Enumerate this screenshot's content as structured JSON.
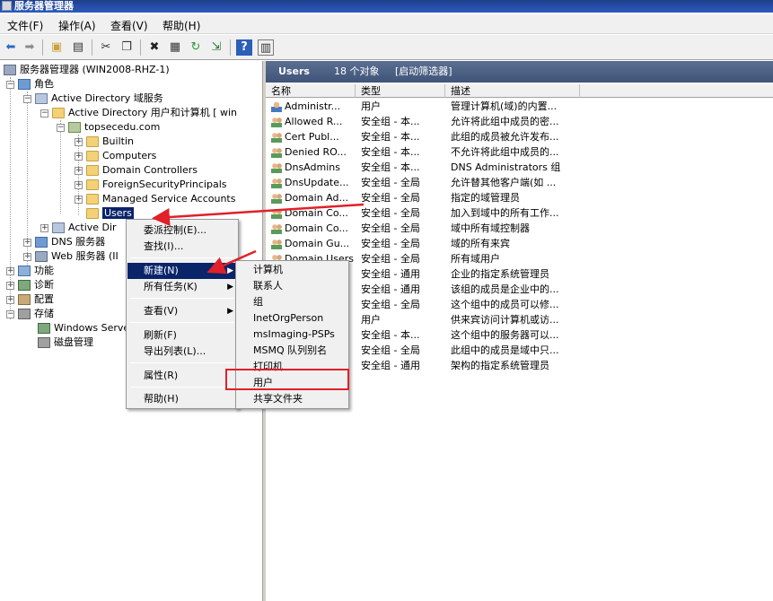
{
  "window": {
    "title": "服务器管理器"
  },
  "menubar": [
    "文件(F)",
    "操作(A)",
    "查看(V)",
    "帮助(H)"
  ],
  "toolbar": {
    "icons": [
      "back-icon",
      "forward-icon",
      "up-folder-icon",
      "show-hide-tree-icon",
      "cut-icon",
      "copy-icon",
      "delete-icon",
      "properties-icon",
      "refresh-icon",
      "export-icon",
      "help-icon",
      "view-icon"
    ]
  },
  "tree": {
    "root": "服务器管理器 (WIN2008-RHZ-1)",
    "roles": "角色",
    "ad_ds": "Active Directory 域服务",
    "aduc": "Active Directory 用户和计算机 [ win",
    "domain": "topsecedu.com",
    "containers": [
      "Builtin",
      "Computers",
      "Domain Controllers",
      "ForeignSecurityPrincipals",
      "Managed Service Accounts",
      "Users"
    ],
    "ad_other": "Active Dir",
    "dns": "DNS 服务器",
    "web": "Web 服务器 (II",
    "features": "功能",
    "diagnostics": "诊断",
    "configuration": "配置",
    "storage": "存储",
    "wsb": "Windows Serve",
    "disk_mgmt": "磁盘管理"
  },
  "right_header": {
    "title": "Users",
    "count": "18 个对象",
    "filter": "[启动筛选器]"
  },
  "columns": [
    "名称",
    "类型",
    "描述"
  ],
  "rows": [
    {
      "icon": "user",
      "name": "Administr...",
      "type": "用户",
      "desc": "管理计算机(域)的内置..."
    },
    {
      "icon": "group",
      "name": "Allowed R...",
      "type": "安全组 - 本...",
      "desc": "允许将此组中成员的密..."
    },
    {
      "icon": "group",
      "name": "Cert Publ...",
      "type": "安全组 - 本...",
      "desc": "此组的成员被允许发布..."
    },
    {
      "icon": "group",
      "name": "Denied RO...",
      "type": "安全组 - 本...",
      "desc": "不允许将此组中成员的..."
    },
    {
      "icon": "group",
      "name": "DnsAdmins",
      "type": "安全组 - 本...",
      "desc": "DNS Administrators 组"
    },
    {
      "icon": "group",
      "name": "DnsUpdate...",
      "type": "安全组 - 全局",
      "desc": "允许替其他客户端(如 ..."
    },
    {
      "icon": "group",
      "name": "Domain Ad...",
      "type": "安全组 - 全局",
      "desc": "指定的域管理员"
    },
    {
      "icon": "group",
      "name": "Domain Co...",
      "type": "安全组 - 全局",
      "desc": "加入到域中的所有工作..."
    },
    {
      "icon": "group",
      "name": "Domain Co...",
      "type": "安全组 - 全局",
      "desc": "域中所有域控制器"
    },
    {
      "icon": "group",
      "name": "Domain Gu...",
      "type": "安全组 - 全局",
      "desc": "域的所有来宾"
    },
    {
      "icon": "group",
      "name": "Domain Users",
      "type": "安全组 - 全局",
      "desc": "所有域用户"
    },
    {
      "icon": "group",
      "name": "",
      "type": "安全组 - 通用",
      "desc": "企业的指定系统管理员"
    },
    {
      "icon": "group",
      "name": "",
      "type": "安全组 - 通用",
      "desc": "该组的成员是企业中的..."
    },
    {
      "icon": "group",
      "name": "",
      "type": "安全组 - 全局",
      "desc": "这个组中的成员可以修..."
    },
    {
      "icon": "user",
      "name": "",
      "type": "用户",
      "desc": "供来宾访问计算机或访..."
    },
    {
      "icon": "group",
      "name": "",
      "type": "安全组 - 本...",
      "desc": "这个组中的服务器可以..."
    },
    {
      "icon": "group",
      "name": "",
      "type": "安全组 - 全局",
      "desc": "此组中的成员是域中只..."
    },
    {
      "icon": "group",
      "name": "",
      "type": "安全组 - 通用",
      "desc": "架构的指定系统管理员"
    }
  ],
  "context_menu": {
    "delegate": "委派控制(E)...",
    "find": "查找(I)...",
    "new": "新建(N)",
    "all_tasks": "所有任务(K)",
    "view": "查看(V)",
    "refresh": "刷新(F)",
    "export": "导出列表(L)...",
    "properties": "属性(R)",
    "help": "帮助(H)"
  },
  "submenu": [
    "计算机",
    "联系人",
    "组",
    "InetOrgPerson",
    "msImaging-PSPs",
    "MSMQ 队列别名",
    "打印机",
    "用户",
    "共享文件夹"
  ],
  "colors": {
    "highlight": "#0a246a",
    "annotation_red": "#e0202a"
  }
}
